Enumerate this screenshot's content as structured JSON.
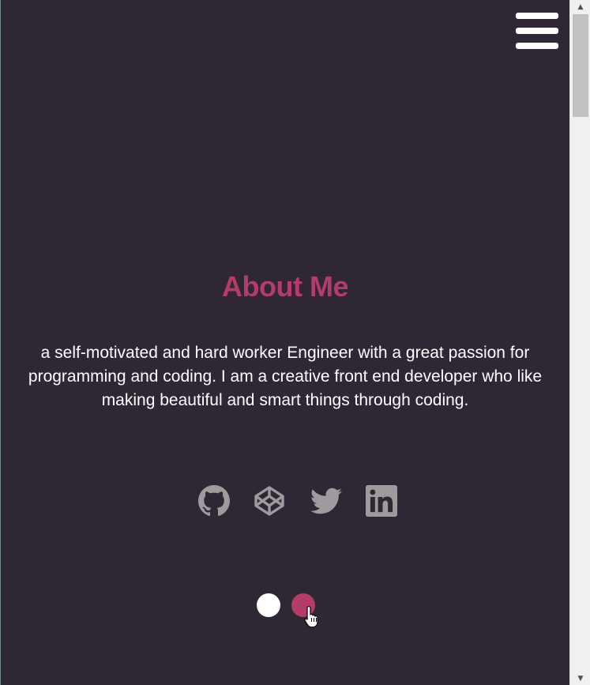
{
  "nav": {
    "menu_icon": "hamburger-menu-icon"
  },
  "about": {
    "title": "About Me",
    "bio": "a self-motivated and hard worker Engineer with a great passion for programming and coding. I am a creative front end developer who like making beautiful and smart things through coding."
  },
  "socials": [
    {
      "icon": "github-icon",
      "label": "GitHub"
    },
    {
      "icon": "codepen-icon",
      "label": "CodePen"
    },
    {
      "icon": "twitter-icon",
      "label": "Twitter"
    },
    {
      "icon": "linkedin-icon",
      "label": "LinkedIn"
    }
  ],
  "theme_toggle": {
    "options": [
      "light",
      "accent"
    ]
  },
  "colors": {
    "background": "#2f2734",
    "accent": "#b33c69",
    "text": "#ffffff",
    "icon": "#9e9a9d"
  },
  "scrollbar": {
    "up_arrow": "▲",
    "down_arrow": "▼"
  }
}
